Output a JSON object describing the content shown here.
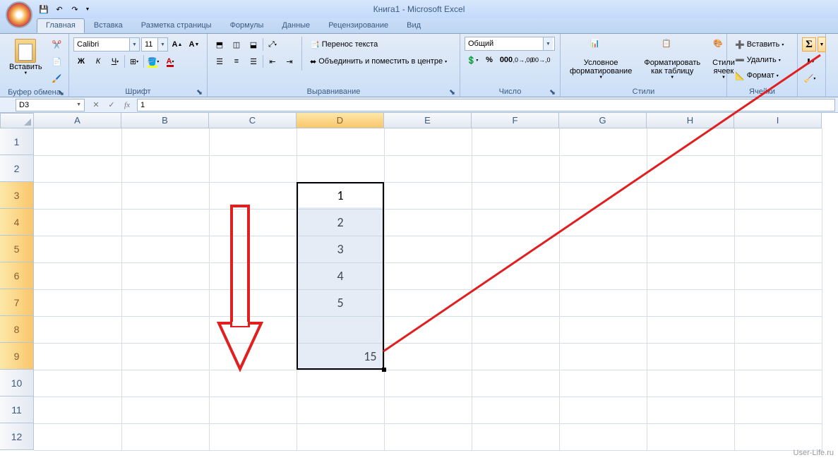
{
  "title": "Книга1 - Microsoft Excel",
  "tabs": [
    "Главная",
    "Вставка",
    "Разметка страницы",
    "Формулы",
    "Данные",
    "Рецензирование",
    "Вид"
  ],
  "active_tab": 0,
  "ribbon": {
    "clipboard": {
      "label": "Буфер обмена",
      "paste": "Вставить"
    },
    "font": {
      "label": "Шрифт",
      "name": "Calibri",
      "size": "11"
    },
    "alignment": {
      "label": "Выравнивание",
      "wrap": "Перенос текста",
      "merge": "Объединить и поместить в центре"
    },
    "number": {
      "label": "Число",
      "format": "Общий"
    },
    "styles": {
      "label": "Стили",
      "cond": "Условное форматирование",
      "table": "Форматировать как таблицу",
      "cell": "Стили ячеек"
    },
    "cells": {
      "label": "Ячейки",
      "insert": "Вставить",
      "delete": "Удалить",
      "format": "Формат"
    }
  },
  "name_box": "D3",
  "formula": "1",
  "columns": [
    "A",
    "B",
    "C",
    "D",
    "E",
    "F",
    "G",
    "H",
    "I"
  ],
  "rows": [
    "1",
    "2",
    "3",
    "4",
    "5",
    "6",
    "7",
    "8",
    "9",
    "10",
    "11",
    "12"
  ],
  "cell_values": {
    "D3": "1",
    "D4": "2",
    "D5": "3",
    "D6": "4",
    "D7": "5",
    "D9": "15"
  },
  "active_column": "D",
  "active_rows_start": 3,
  "active_rows_end": 9,
  "watermark": "User-Life.ru"
}
